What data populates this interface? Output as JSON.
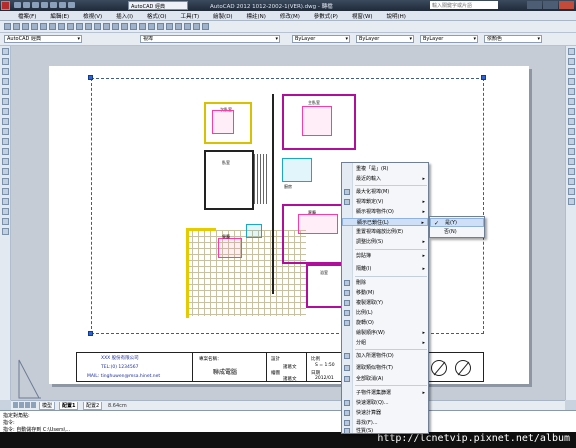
{
  "app": {
    "window_title": "AutoCAD 2012   1012-2002-1(VER).dwg - 轉檔",
    "workspace": "AutoCAD 經典",
    "search_placeholder": "輸入關鍵字或片語"
  },
  "menu": [
    "檔案(F)",
    "編輯(E)",
    "檢視(V)",
    "插入(I)",
    "格式(O)",
    "工具(T)",
    "繪製(D)",
    "標註(N)",
    "修改(M)",
    "參數式(P)",
    "視窗(W)",
    "說明(H)"
  ],
  "toolbar": {
    "workspace_combo": "AutoCAD 經典",
    "layer_combo": "視埠",
    "color_combo": "ByLayer",
    "linetype_combo": "ByLayer",
    "lineweight_combo": "ByLayer",
    "plotstyle_combo": "依顏色"
  },
  "context_menu": {
    "items": [
      {
        "label": "重複「是」(R)",
        "arrow": false
      },
      {
        "label": "最近的輸入",
        "arrow": true
      },
      {
        "label": "最大化視埠(M)",
        "arrow": false
      },
      {
        "label": "視埠鎖定(V)",
        "arrow": true
      },
      {
        "label": "顯示視埠物件(O)",
        "arrow": true
      },
      {
        "label": "顯示已鎖住(L)",
        "arrow": true,
        "highlighted": true
      },
      {
        "label": "重置視埠縮放比例(E)",
        "arrow": false
      },
      {
        "label": "調整比例(S)",
        "arrow": true
      },
      {
        "label": "剪貼簿",
        "arrow": true
      },
      {
        "label": "隔離(I)",
        "arrow": true
      },
      {
        "label": "刪除",
        "arrow": false
      },
      {
        "label": "移動(M)",
        "arrow": false
      },
      {
        "label": "複製選取(Y)",
        "arrow": false
      },
      {
        "label": "比例(L)",
        "arrow": false
      },
      {
        "label": "旋轉(O)",
        "arrow": false
      },
      {
        "label": "繪製順序(W)",
        "arrow": true
      },
      {
        "label": "分組",
        "arrow": true
      },
      {
        "label": "加入所選物件(D)",
        "arrow": false
      },
      {
        "label": "選取類似物件(T)",
        "arrow": false
      },
      {
        "label": "全部取消(A)",
        "arrow": false
      },
      {
        "label": "子物件選集篩選",
        "arrow": true
      },
      {
        "label": "快速選取(Q)...",
        "arrow": false
      },
      {
        "label": "快速計算器",
        "arrow": false
      },
      {
        "label": "尋找(F)...",
        "arrow": false
      },
      {
        "label": "性質(S)",
        "arrow": false
      }
    ]
  },
  "submenu": {
    "items": [
      {
        "label": "是(Y)",
        "checked": true,
        "highlighted": true
      },
      {
        "label": "否(N)",
        "checked": false
      }
    ]
  },
  "plan_labels": {
    "room1": "主臥室",
    "room2": "次臥室",
    "room3": "餐廳",
    "room4": "客廳",
    "room5": "臥室",
    "room6": "浴室",
    "room7": "廚房"
  },
  "titleblock": {
    "company": "XXX 股份有限公司",
    "tel": "TEL:(0) 1234567",
    "mail": "MAIL: tinghuwen@msa.hinet.net",
    "project_label": "專案名稱：",
    "project_name": "聯成電腦",
    "drawn_label": "設計",
    "drawn_by": "諸葛文",
    "check_label": "繪圖",
    "checked_by": "諸葛文",
    "scale_label": "比例",
    "scale": "S = 1:50",
    "date_label": "日期",
    "date": "2012/01"
  },
  "tabs": {
    "items": [
      "模型",
      "配置1",
      "配置2"
    ],
    "active_index": 1,
    "coordinate": "8.64cm"
  },
  "command": {
    "line1": "指定對角點:",
    "line2": "指令:",
    "line3": "指令: 自動儲存到 C:\\Users\\..."
  },
  "watermark": "http://lcnetvip.pixnet.net/album"
}
